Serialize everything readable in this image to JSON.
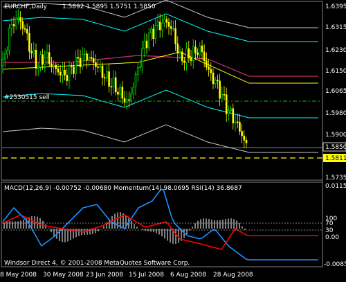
{
  "main_chart": {
    "symbol_label": "EURCHF,Daily",
    "ohlc_label": "1.5892 1.5895 1.5751 1.5850",
    "order_label": "#2530515 sell",
    "price_axis": [
      "1.6395",
      "1.6315",
      "1.6230",
      "1.6150",
      "1.6065",
      "1.5980",
      "1.5900",
      "1.5735"
    ],
    "current_price": "1.5850",
    "order_price": "1.5811"
  },
  "indicator": {
    "label": "MACD(12,26,9) -0.00752 -0.00680  Momentum(14) 98.0695  RSI(14) 36.8687",
    "axis": [
      "0.01153",
      "100",
      "70",
      "30",
      "0.00",
      "-0.00855"
    ],
    "footer": "Windsor Direct 4, © 2001-2008 MetaQuotes Software Corp."
  },
  "time_axis": [
    "8 May 2008",
    "30 May 2008",
    "23 Jun 2008",
    "15 Jul 2008",
    "6 Aug 2008",
    "28 Aug 2008"
  ],
  "colors": {
    "background": "#000000",
    "bull": "#00ff00",
    "bear": "#ffff00",
    "macd_hist": "#ffffff",
    "momentum": "#1e90ff",
    "rsi": "#ff0000",
    "bands_outer": "#c8c8c8",
    "bands_cyan": "#00ffff",
    "ma_red": "#c03060",
    "ma_yellow": "#ffff00",
    "order_line": "#ffff00",
    "sl_line": "#00cc00"
  }
}
